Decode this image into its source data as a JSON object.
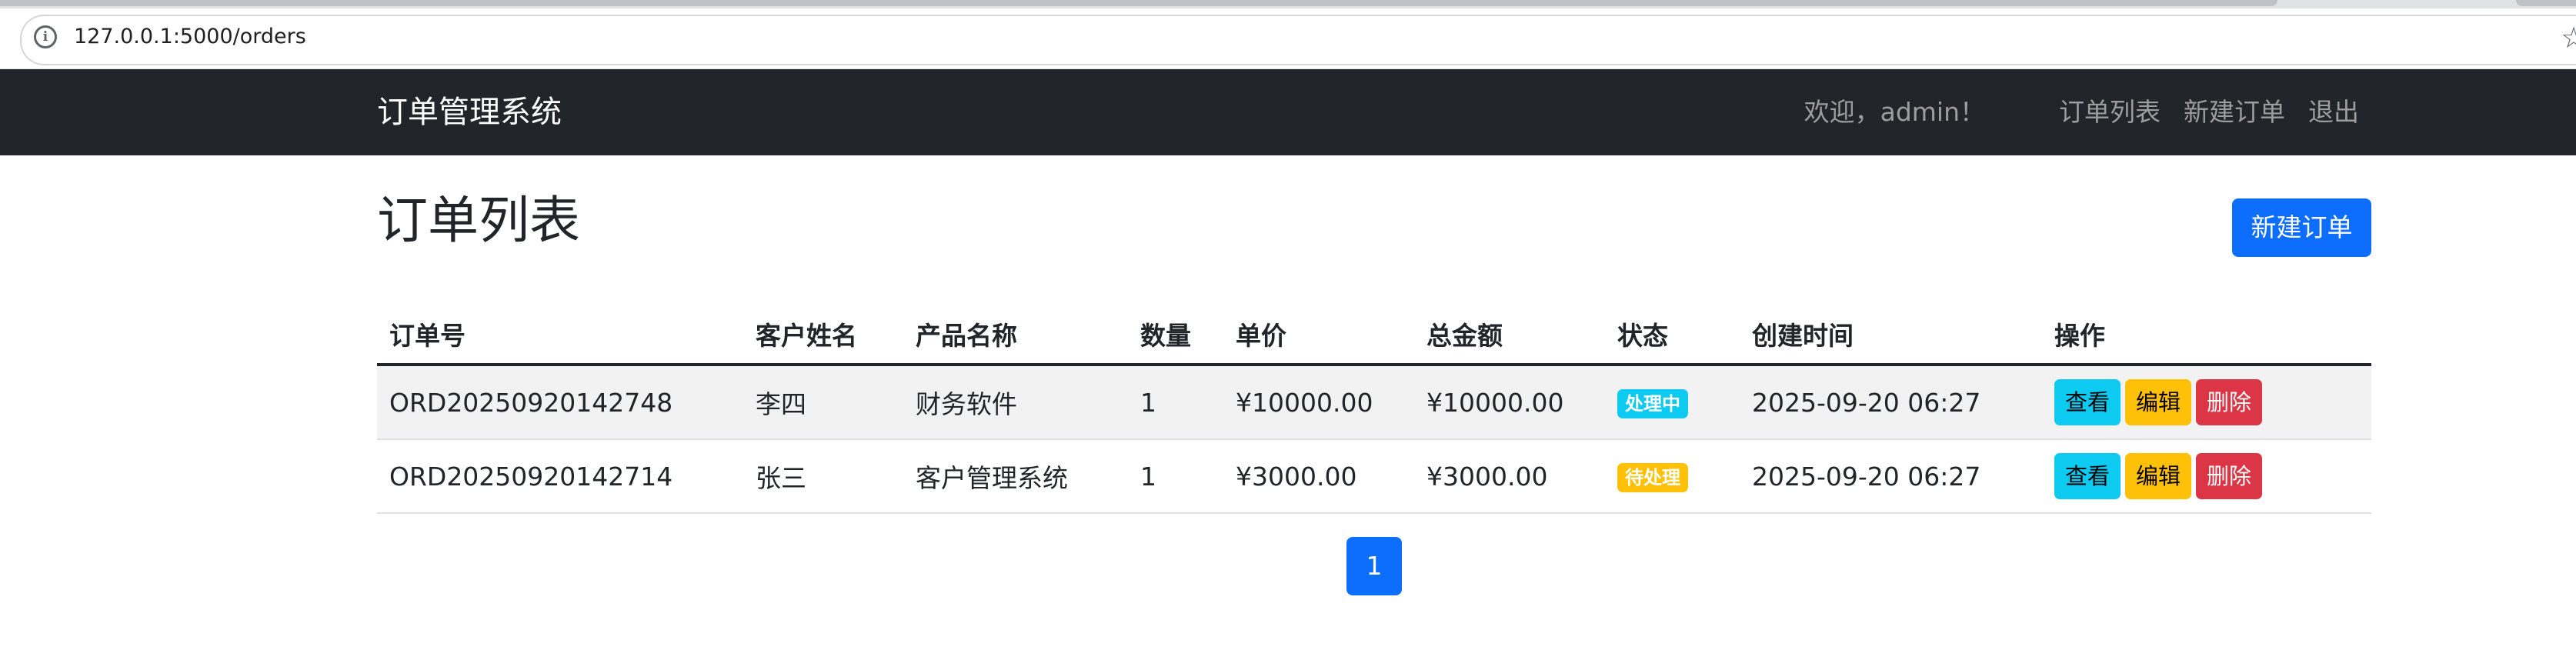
{
  "browser": {
    "url": "127.0.0.1:5000/orders",
    "info_icon": "info-icon",
    "star_icon": "bookmark-star-icon"
  },
  "navbar": {
    "brand": "订单管理系统",
    "welcome": "欢迎，admin！",
    "links": [
      "订单列表",
      "新建订单",
      "退出"
    ]
  },
  "page": {
    "title": "订单列表",
    "new_order_button": "新建订单"
  },
  "table": {
    "headers": [
      "订单号",
      "客户姓名",
      "产品名称",
      "数量",
      "单价",
      "总金额",
      "状态",
      "创建时间",
      "操作"
    ],
    "rows": [
      {
        "order_no": "ORD20250920142748",
        "customer": "李四",
        "product": "财务软件",
        "quantity": "1",
        "unit_price": "¥10000.00",
        "total": "¥10000.00",
        "status": "处理中",
        "created": "2025-09-20 06:27",
        "actions": [
          "查看",
          "编辑",
          "删除"
        ]
      },
      {
        "order_no": "ORD20250920142714",
        "customer": "张三",
        "product": "客户管理系统",
        "quantity": "1",
        "unit_price": "¥3000.00",
        "total": "¥3000.00",
        "status": "待处理",
        "created": "2025-09-20 06:27",
        "actions": [
          "查看",
          "编辑",
          "删除"
        ]
      }
    ]
  },
  "pagination": {
    "current_page": "1"
  },
  "colors": {
    "primary": "#0d6efd",
    "info": "#0dcaf0",
    "warning": "#ffc107",
    "danger": "#dc3545",
    "navbar": "#212529"
  }
}
